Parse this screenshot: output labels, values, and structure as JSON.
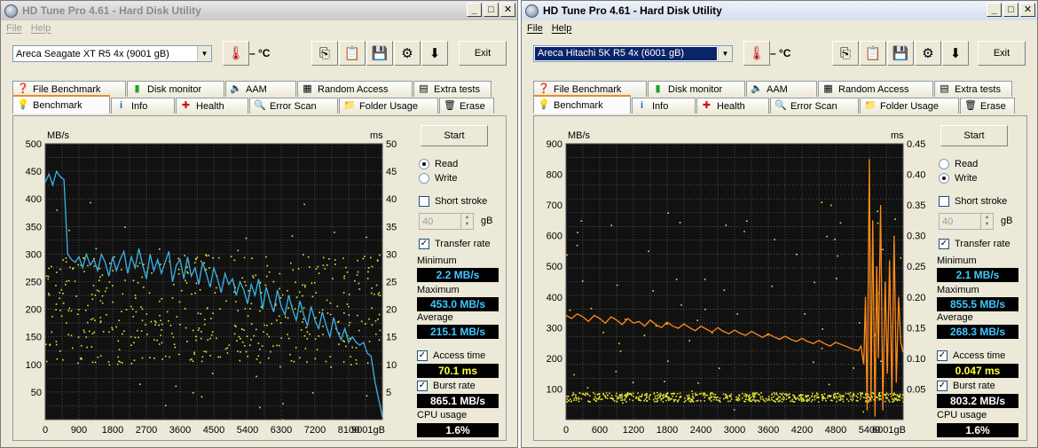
{
  "windows": [
    {
      "title": "HD Tune Pro 4.61 - Hard Disk Utility",
      "active": false,
      "menu": [
        "File",
        "Help"
      ],
      "drive": "Areca   Seagate XT R5 4x (9001 gB)",
      "temp": "– °C",
      "exit_label": "Exit",
      "tabs_row1": [
        {
          "label": "File Benchmark",
          "icon": "file-benchmark-icon"
        },
        {
          "label": "Disk monitor",
          "icon": "disk-monitor-icon"
        },
        {
          "label": "AAM",
          "icon": "speaker-icon"
        },
        {
          "label": "Random Access",
          "icon": "random-access-icon"
        },
        {
          "label": "Extra tests",
          "icon": "extra-tests-icon"
        }
      ],
      "tabs_row2": [
        {
          "label": "Benchmark",
          "icon": "bulb-icon",
          "active": true
        },
        {
          "label": "Info",
          "icon": "info-icon"
        },
        {
          "label": "Health",
          "icon": "health-cross-icon"
        },
        {
          "label": "Error Scan",
          "icon": "magnifier-icon"
        },
        {
          "label": "Folder Usage",
          "icon": "folder-icon"
        },
        {
          "label": "Erase",
          "icon": "trash-icon"
        }
      ],
      "side": {
        "start": "Start",
        "read": "Read",
        "write": "Write",
        "mode": "read",
        "short_stroke": "Short stroke",
        "short_stroke_checked": false,
        "stroke_value": "40",
        "stroke_unit": "gB",
        "transfer_rate": "Transfer rate",
        "transfer_rate_checked": true,
        "minimum_label": "Minimum",
        "minimum": "2.2 MB/s",
        "maximum_label": "Maximum",
        "maximum": "453.0 MB/s",
        "average_label": "Average",
        "average": "215.1 MB/s",
        "access_time": "Access time",
        "access_time_checked": true,
        "access_value": "70.1 ms",
        "burst_rate": "Burst rate",
        "burst_rate_checked": true,
        "burst_value": "865.1 MB/s",
        "cpu_label": "CPU usage",
        "cpu_value": "1.6%"
      }
    },
    {
      "title": "HD Tune Pro 4.61 - Hard Disk Utility",
      "active": true,
      "menu": [
        "File",
        "Help"
      ],
      "drive": "Areca   Hitachi 5K R5 4x (6001 gB)",
      "temp": "– °C",
      "exit_label": "Exit",
      "tabs_row1": [
        {
          "label": "File Benchmark",
          "icon": "file-benchmark-icon"
        },
        {
          "label": "Disk monitor",
          "icon": "disk-monitor-icon"
        },
        {
          "label": "AAM",
          "icon": "speaker-icon"
        },
        {
          "label": "Random Access",
          "icon": "random-access-icon"
        },
        {
          "label": "Extra tests",
          "icon": "extra-tests-icon"
        }
      ],
      "tabs_row2": [
        {
          "label": "Benchmark",
          "icon": "bulb-icon",
          "active": true
        },
        {
          "label": "Info",
          "icon": "info-icon"
        },
        {
          "label": "Health",
          "icon": "health-cross-icon"
        },
        {
          "label": "Error Scan",
          "icon": "magnifier-icon"
        },
        {
          "label": "Folder Usage",
          "icon": "folder-icon"
        },
        {
          "label": "Erase",
          "icon": "trash-icon"
        }
      ],
      "side": {
        "start": "Start",
        "read": "Read",
        "write": "Write",
        "mode": "write",
        "short_stroke": "Short stroke",
        "short_stroke_checked": false,
        "stroke_value": "40",
        "stroke_unit": "gB",
        "transfer_rate": "Transfer rate",
        "transfer_rate_checked": true,
        "minimum_label": "Minimum",
        "minimum": "2.1 MB/s",
        "maximum_label": "Maximum",
        "maximum": "855.5 MB/s",
        "average_label": "Average",
        "average": "268.3 MB/s",
        "access_time": "Access time",
        "access_time_checked": true,
        "access_value": "0.047 ms",
        "burst_rate": "Burst rate",
        "burst_rate_checked": true,
        "burst_value": "803.2 MB/s",
        "cpu_label": "CPU usage",
        "cpu_value": "1.6%"
      }
    }
  ],
  "chart_data": [
    {
      "type": "line",
      "colors": {
        "transfer": "#3ab4e6",
        "access": "#e6e633",
        "background": "#111111",
        "grid": "#7a7a7a"
      },
      "xlabel_unit": "gB",
      "ylabel_left": "MB/s",
      "ylabel_right": "ms",
      "xlim": [
        0,
        9001
      ],
      "ylim_left": [
        0,
        500
      ],
      "ylim_right": [
        0,
        50
      ],
      "x_ticks": [
        "0",
        "900",
        "1800",
        "2700",
        "3600",
        "4500",
        "5400",
        "6300",
        "7200",
        "8100",
        "9001gB"
      ],
      "y_ticks_left": [
        "500",
        "450",
        "400",
        "350",
        "300",
        "250",
        "200",
        "150",
        "100",
        "50"
      ],
      "y_ticks_right": [
        "50",
        "45",
        "40",
        "35",
        "30",
        "25",
        "20",
        "15",
        "10",
        "5"
      ],
      "transfer_series": {
        "x": [
          0,
          100,
          200,
          300,
          400,
          500,
          600,
          700,
          800,
          900,
          1000,
          1100,
          1200,
          1300,
          1400,
          1500,
          1600,
          1700,
          1800,
          1900,
          2000,
          2100,
          2200,
          2300,
          2400,
          2500,
          2600,
          2700,
          2800,
          2900,
          3000,
          3100,
          3200,
          3300,
          3400,
          3500,
          3600,
          3700,
          3800,
          3900,
          4000,
          4100,
          4200,
          4300,
          4400,
          4500,
          4600,
          4700,
          4800,
          4900,
          5000,
          5100,
          5200,
          5300,
          5400,
          5500,
          5600,
          5700,
          5800,
          5900,
          6000,
          6100,
          6200,
          6300,
          6400,
          6500,
          6600,
          6700,
          6800,
          6900,
          7000,
          7100,
          7200,
          7300,
          7400,
          7500,
          7600,
          7700,
          7800,
          7900,
          8000,
          8100,
          8200,
          8300,
          8400,
          8500,
          8600,
          8700,
          8800,
          9001
        ],
        "y": [
          430,
          445,
          425,
          450,
          440,
          435,
          300,
          290,
          285,
          295,
          275,
          300,
          280,
          290,
          270,
          300,
          285,
          260,
          295,
          270,
          290,
          305,
          265,
          295,
          275,
          310,
          280,
          255,
          300,
          270,
          290,
          265,
          285,
          305,
          250,
          280,
          290,
          255,
          295,
          260,
          275,
          245,
          285,
          265,
          240,
          275,
          255,
          230,
          265,
          245,
          255,
          225,
          250,
          235,
          210,
          245,
          225,
          255,
          200,
          240,
          215,
          195,
          235,
          205,
          190,
          225,
          200,
          180,
          215,
          190,
          170,
          205,
          180,
          165,
          195,
          170,
          150,
          185,
          160,
          145,
          165,
          140,
          150,
          140,
          135,
          140,
          120,
          115,
          70,
          5
        ]
      },
      "access_scatter_band_ms": [
        10,
        30
      ]
    },
    {
      "type": "line",
      "colors": {
        "transfer": "#ff8c1a",
        "access": "#e6e633",
        "background": "#111111",
        "grid": "#7a7a7a"
      },
      "xlabel_unit": "gB",
      "ylabel_left": "MB/s",
      "ylabel_right": "ms",
      "xlim": [
        0,
        6001
      ],
      "ylim_left": [
        0,
        900
      ],
      "ylim_right": [
        0,
        0.45
      ],
      "x_ticks": [
        "0",
        "600",
        "1200",
        "1800",
        "2400",
        "3000",
        "3600",
        "4200",
        "4800",
        "5400",
        "6001gB"
      ],
      "y_ticks_left": [
        "900",
        "800",
        "700",
        "600",
        "500",
        "400",
        "300",
        "200",
        "100"
      ],
      "y_ticks_right": [
        "0.45",
        "0.40",
        "0.35",
        "0.30",
        "0.25",
        "0.20",
        "0.15",
        "0.10",
        "0.05"
      ],
      "transfer_series": {
        "x": [
          0,
          100,
          200,
          300,
          400,
          500,
          600,
          700,
          800,
          900,
          1000,
          1100,
          1200,
          1300,
          1400,
          1500,
          1600,
          1700,
          1800,
          1900,
          2000,
          2100,
          2200,
          2300,
          2400,
          2500,
          2600,
          2700,
          2800,
          2900,
          3000,
          3100,
          3200,
          3300,
          3400,
          3500,
          3600,
          3700,
          3800,
          3900,
          4000,
          4100,
          4200,
          4300,
          4400,
          4500,
          4600,
          4700,
          4800,
          4900,
          5000,
          5100,
          5200,
          5250,
          5300,
          5330,
          5360,
          5400,
          5430,
          5460,
          5500,
          5530,
          5560,
          5600,
          5640,
          5680,
          5720,
          5760,
          5800,
          5840,
          5880,
          5920,
          5960,
          6001
        ],
        "y": [
          340,
          330,
          345,
          335,
          320,
          340,
          330,
          315,
          335,
          325,
          310,
          330,
          315,
          320,
          305,
          325,
          310,
          300,
          318,
          305,
          298,
          312,
          300,
          290,
          305,
          295,
          285,
          300,
          288,
          280,
          292,
          282,
          275,
          288,
          278,
          268,
          280,
          270,
          262,
          272,
          262,
          255,
          265,
          255,
          248,
          258,
          248,
          240,
          252,
          245,
          238,
          230,
          225,
          240,
          180,
          400,
          30,
          850,
          60,
          650,
          10,
          500,
          200,
          700,
          30,
          450,
          150,
          520,
          80,
          600,
          120,
          400,
          250,
          220
        ]
      },
      "access_scatter_band_ms": [
        0.03,
        0.045
      ]
    }
  ]
}
